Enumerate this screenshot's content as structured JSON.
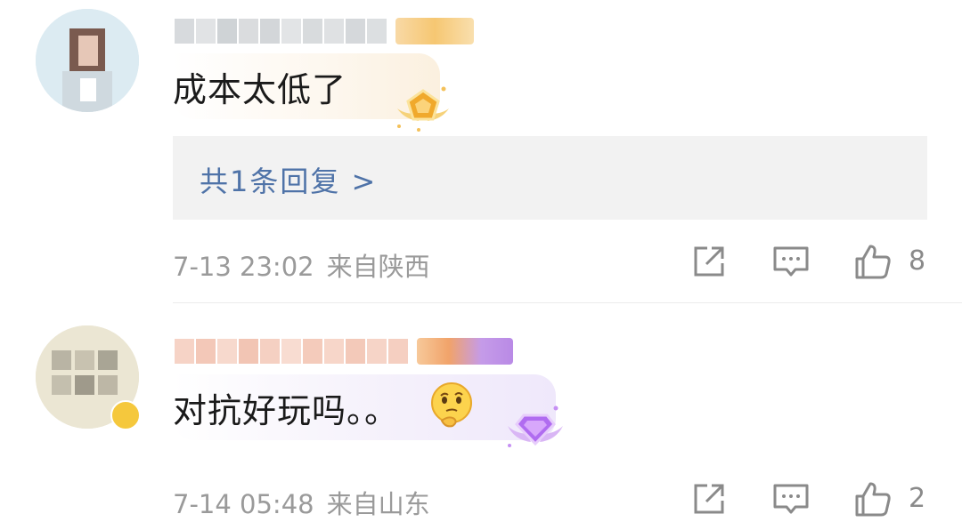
{
  "comments": [
    {
      "text": "成本太低了",
      "reply_summary": "共1条回复 >",
      "time": "7-13 23:02",
      "location": "来自陕西",
      "likes": "8",
      "icons": [
        "share-icon",
        "comment-icon",
        "like-icon"
      ]
    },
    {
      "text": "对抗好玩吗。。",
      "time": "7-14 05:48",
      "location": "来自山东",
      "likes": "2",
      "icons": [
        "share-icon",
        "comment-icon",
        "like-icon"
      ]
    }
  ],
  "colors": {
    "reply_link": "#4f73a8",
    "meta_text": "#9a9a9a",
    "reply_bg": "#f2f2f2"
  }
}
